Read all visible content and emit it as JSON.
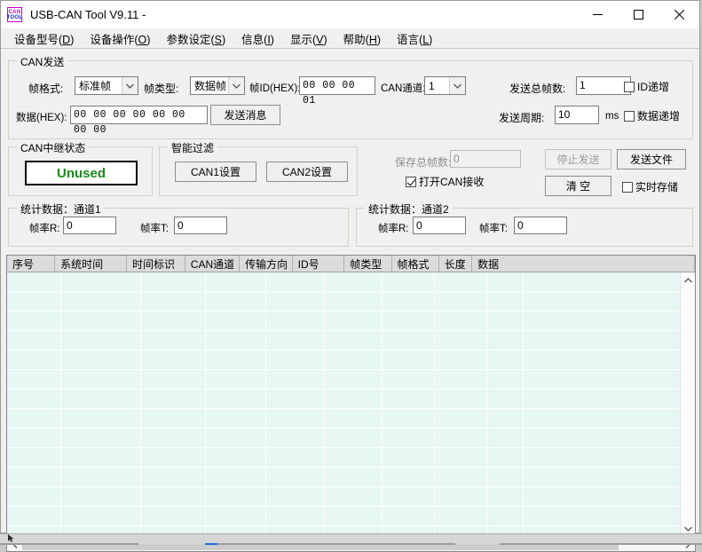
{
  "window": {
    "title": "USB-CAN Tool V9.11 -",
    "icon_line1": "CAN",
    "icon_line2": "TOOL",
    "controls": {
      "minimize": "minimize-icon",
      "maximize": "maximize-icon",
      "close": "close-icon"
    }
  },
  "menubar": {
    "items": [
      {
        "label": "设备型号(D)",
        "text": "设备型号(",
        "accel": "D",
        "tail": ")"
      },
      {
        "label": "设备操作(O)",
        "text": "设备操作(",
        "accel": "O",
        "tail": ")"
      },
      {
        "label": "参数设定(S)",
        "text": "参数设定(",
        "accel": "S",
        "tail": ")"
      },
      {
        "label": "信息(I)",
        "text": "信息(",
        "accel": "I",
        "tail": ")"
      },
      {
        "label": "显示(V)",
        "text": "显示(",
        "accel": "V",
        "tail": ")"
      },
      {
        "label": "帮助(H)",
        "text": "帮助(",
        "accel": "H",
        "tail": ")"
      },
      {
        "label": "语言(L)",
        "text": "语言(",
        "accel": "L",
        "tail": ")"
      }
    ]
  },
  "can_send": {
    "title": "CAN发送",
    "frame_format_label": "帧格式:",
    "frame_format_value": "标准帧",
    "frame_type_label": "帧类型:",
    "frame_type_value": "数据帧",
    "frame_id_label": "帧ID(HEX):",
    "frame_id_value": "00 00 00 01",
    "can_channel_label": "CAN通道:",
    "can_channel_value": "1",
    "total_frames_label": "发送总帧数:",
    "total_frames_value": "1",
    "id_increment_label": "ID递增",
    "id_increment_checked": false,
    "data_label": "数据(HEX):",
    "data_value": "00 00 00 00 00 00 00 00",
    "send_message_button": "发送消息",
    "period_label": "发送周期:",
    "period_value": "10",
    "period_unit": "ms",
    "data_increment_label": "数据递增",
    "data_increment_checked": false
  },
  "relay_status": {
    "title": "CAN中继状态",
    "value": "Unused",
    "value_color": "#1a8a1a"
  },
  "smart_filter": {
    "title": "智能过滤",
    "can1_button": "CAN1设置",
    "can2_button": "CAN2设置"
  },
  "receive_controls": {
    "saved_frames_label": "保存总帧数:",
    "saved_frames_value": "0",
    "saved_frames_disabled": true,
    "open_can_receive_label": "打开CAN接收",
    "open_can_receive_checked": true,
    "stop_send_button": "停止发送",
    "stop_send_disabled": true,
    "send_file_button": "发送文件",
    "clear_button": "清 空",
    "realtime_save_label": "实时存储",
    "realtime_save_checked": false
  },
  "stats_ch1": {
    "title": "统计数据：通道1",
    "rate_r_label": "帧率R:",
    "rate_r_value": "0",
    "rate_t_label": "帧率T:",
    "rate_t_value": "0"
  },
  "stats_ch2": {
    "title": "统计数据：通道2",
    "rate_r_label": "帧率R:",
    "rate_r_value": "0",
    "rate_t_label": "帧率T:",
    "rate_t_value": "0"
  },
  "message_table": {
    "columns": [
      {
        "label": "序号",
        "width": 60
      },
      {
        "label": "系统时间",
        "width": 90
      },
      {
        "label": "时间标识",
        "width": 73
      },
      {
        "label": "CAN通道",
        "width": 68
      },
      {
        "label": "传输方向",
        "width": 66
      },
      {
        "label": "ID号",
        "width": 65
      },
      {
        "label": "帧类型",
        "width": 59
      },
      {
        "label": "帧格式",
        "width": 59
      },
      {
        "label": "长度",
        "width": 41
      },
      {
        "label": "数据",
        "width": 180
      }
    ],
    "rows": [],
    "empty": true,
    "body_color": "#e6f7f4"
  },
  "scrollbars": {
    "vertical_up": "scroll-up-icon",
    "vertical_down": "scroll-down-icon",
    "horizontal_left": "scroll-left-icon",
    "horizontal_right": "scroll-right-icon"
  }
}
